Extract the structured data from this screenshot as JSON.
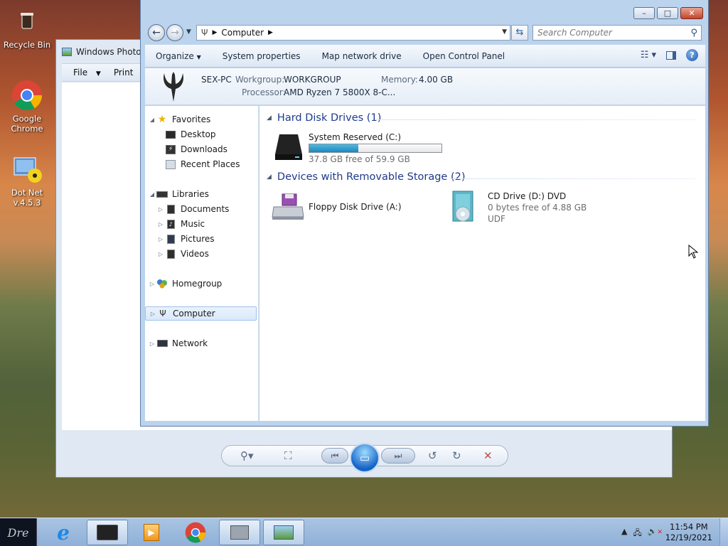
{
  "desktop": {
    "icons": [
      {
        "label": "Recycle Bin",
        "icon": "recycle-bin-icon"
      },
      {
        "label": "Google Chrome",
        "icon": "chrome-icon"
      },
      {
        "label": "Dot Net v.4.5.3",
        "icon": "dotnet-installer-icon"
      }
    ]
  },
  "photo_viewer": {
    "title": "Windows Photo V",
    "menu": {
      "file": "File",
      "print": "Print"
    }
  },
  "explorer": {
    "controls": {
      "minimize": "–",
      "maximize": "□",
      "close": "✕"
    },
    "address": {
      "crumb": "Computer"
    },
    "search": {
      "placeholder": "Search Computer"
    },
    "toolbar": {
      "organize": "Organize",
      "system_properties": "System properties",
      "map_network_drive": "Map network drive",
      "open_control_panel": "Open Control Panel"
    },
    "info": {
      "computer_name": "SEX-PC",
      "workgroup_label": "Workgroup:",
      "workgroup_value": "WORKGROUP",
      "memory_label": "Memory:",
      "memory_value": "4.00 GB",
      "processor_label": "Processor:",
      "processor_value": "AMD Ryzen 7 5800X 8-C..."
    },
    "nav": {
      "favorites": "Favorites",
      "desktop": "Desktop",
      "downloads": "Downloads",
      "recent_places": "Recent Places",
      "libraries": "Libraries",
      "documents": "Documents",
      "music": "Music",
      "pictures": "Pictures",
      "videos": "Videos",
      "homegroup": "Homegroup",
      "computer": "Computer",
      "network": "Network"
    },
    "content": {
      "hdd_group": "Hard Disk Drives (1)",
      "removable_group": "Devices with Removable Storage (2)",
      "drive_c": {
        "name": "System Reserved (C:)",
        "free": "37.8 GB free of 59.9 GB",
        "used_fraction": 0.369
      },
      "floppy": {
        "name": "Floppy Disk Drive (A:)"
      },
      "cd": {
        "name": "CD Drive (D:) DVD",
        "free": "0 bytes free of 4.88 GB",
        "fs": "UDF"
      }
    }
  },
  "taskbar": {
    "start_label": "Dre",
    "time": "11:54 PM",
    "date": "12/19/2021"
  }
}
